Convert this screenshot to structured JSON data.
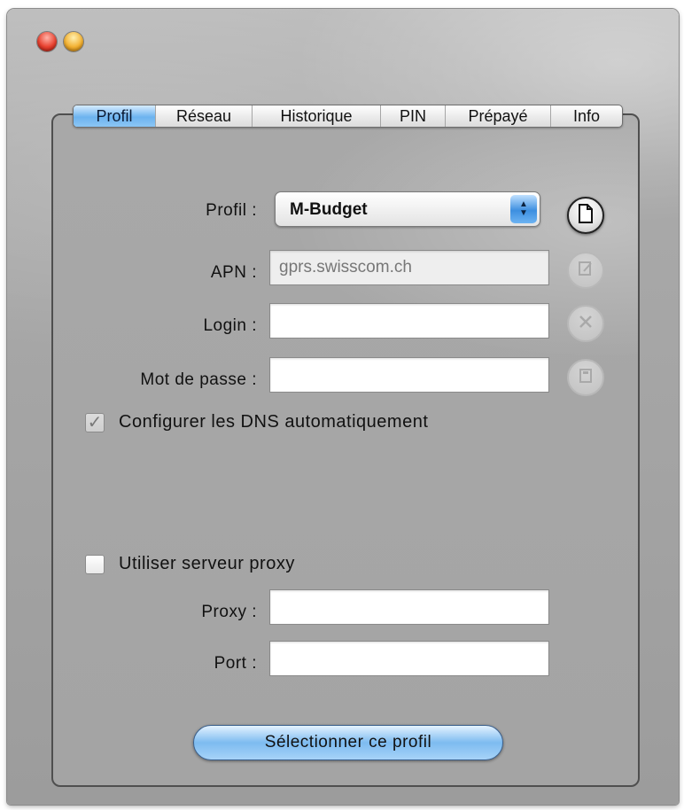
{
  "window": {
    "traffic_lights": [
      "close",
      "minimize"
    ]
  },
  "tabs": [
    {
      "label": "Profil",
      "active": true
    },
    {
      "label": "Réseau",
      "active": false
    },
    {
      "label": "Historique",
      "active": false
    },
    {
      "label": "PIN",
      "active": false
    },
    {
      "label": "Prépayé",
      "active": false
    },
    {
      "label": "Info",
      "active": false
    }
  ],
  "profile": {
    "profil_label": "Profil :",
    "profil_value": "M-Budget",
    "apn_label": "APN :",
    "apn_value": "gprs.swisscom.ch",
    "login_label": "Login :",
    "login_value": "",
    "password_label": "Mot de passe :",
    "password_value": "",
    "dns_checkbox_label": "Configurer les DNS automatiquement",
    "dns_checked": true,
    "proxy_checkbox_label": "Utiliser serveur proxy",
    "proxy_checked": false,
    "proxy_label": "Proxy :",
    "proxy_value": "",
    "port_label": "Port :",
    "port_value": ""
  },
  "side_buttons": [
    {
      "icon": "new-document-icon",
      "enabled": true
    },
    {
      "icon": "edit-icon",
      "enabled": false
    },
    {
      "icon": "delete-icon",
      "enabled": false
    },
    {
      "icon": "save-icon",
      "enabled": false
    }
  ],
  "footer": {
    "select_button_label": "Sélectionner ce profil"
  },
  "colors": {
    "accent": "#6cb3ef",
    "window_bg": "#a8a8a8"
  }
}
